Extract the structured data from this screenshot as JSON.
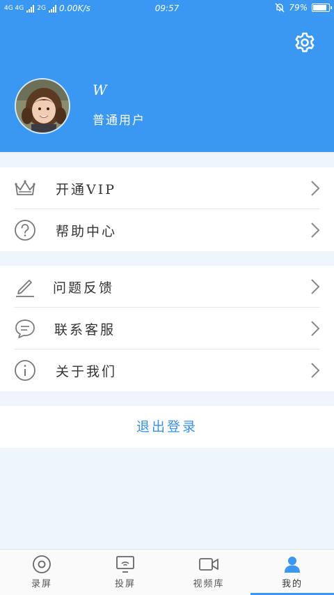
{
  "status_bar": {
    "network": "4G 4G",
    "network2": "2G",
    "speed": "0.00K/s",
    "time": "09:57",
    "battery": "79%"
  },
  "profile": {
    "name": "W",
    "type": "普通用户"
  },
  "menu_group1": [
    {
      "label": "开通VIP",
      "icon": "crown-icon"
    },
    {
      "label": "帮助中心",
      "icon": "question-circle-icon"
    }
  ],
  "menu_group2": [
    {
      "label": "问题反馈",
      "icon": "pencil-icon"
    },
    {
      "label": "联系客服",
      "icon": "chat-bubble-icon"
    },
    {
      "label": "关于我们",
      "icon": "info-circle-icon"
    }
  ],
  "logout_label": "退出登录",
  "tabs": [
    {
      "label": "录屏",
      "icon": "record-icon"
    },
    {
      "label": "投屏",
      "icon": "cast-icon"
    },
    {
      "label": "视频库",
      "icon": "video-camera-icon"
    },
    {
      "label": "我的",
      "icon": "user-icon",
      "active": true
    }
  ],
  "colors": {
    "primary": "#3a97f2",
    "background": "#eef5fd",
    "logout_text": "#3a8fe8"
  }
}
